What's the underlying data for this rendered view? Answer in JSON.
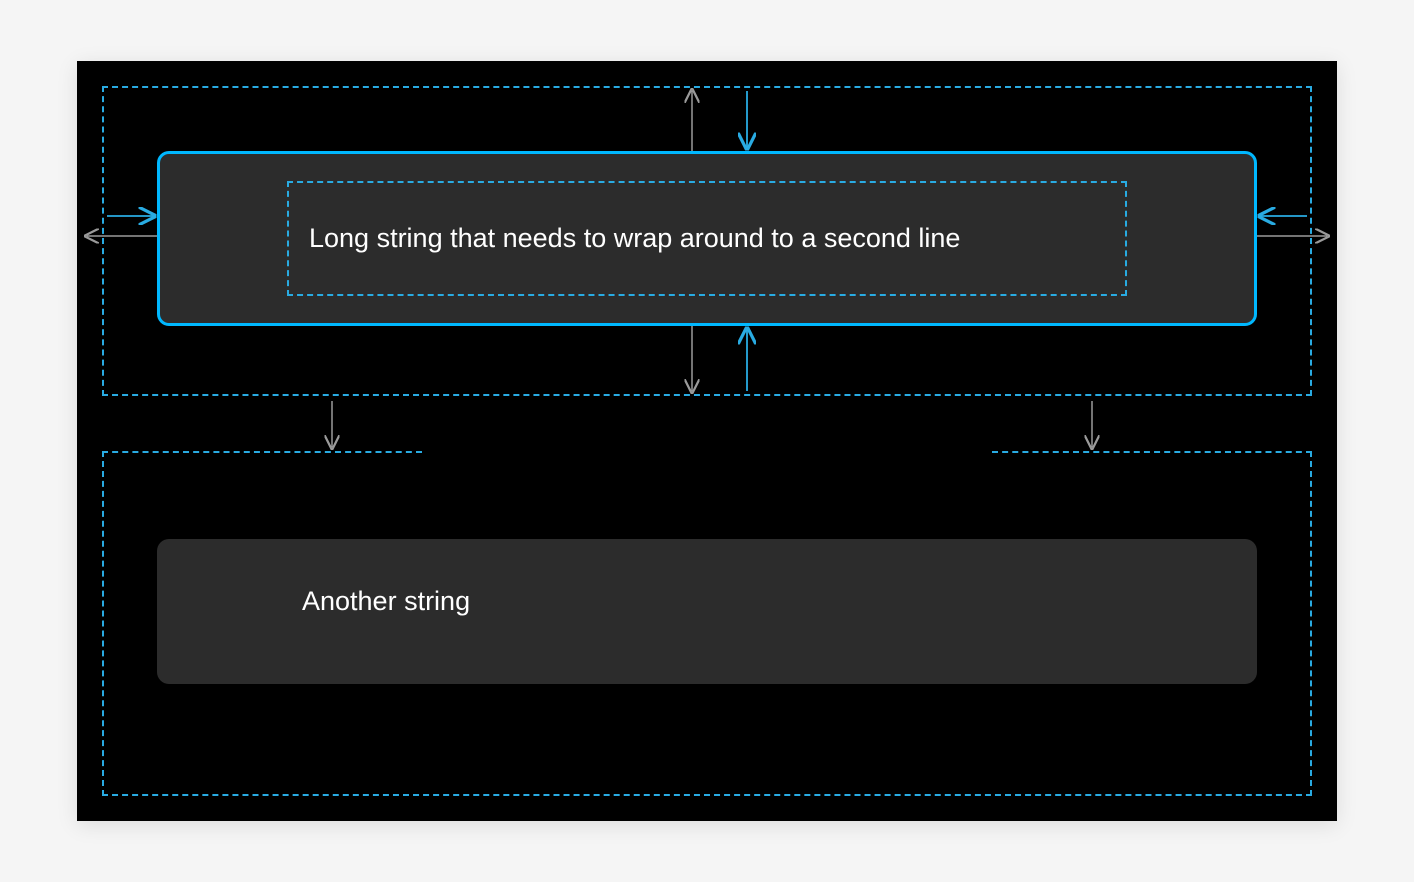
{
  "rows": [
    {
      "text": "Long string that needs to wrap around to a second line"
    },
    {
      "text": "Another string"
    }
  ],
  "colors": {
    "canvas_bg": "#000000",
    "card_bg": "#2c2c2c",
    "dashed_border": "#29abe2",
    "selected_border": "#00b8ff",
    "arrow_gray": "#9a9a9a",
    "arrow_blue": "#29abe2",
    "text": "#ffffff"
  }
}
